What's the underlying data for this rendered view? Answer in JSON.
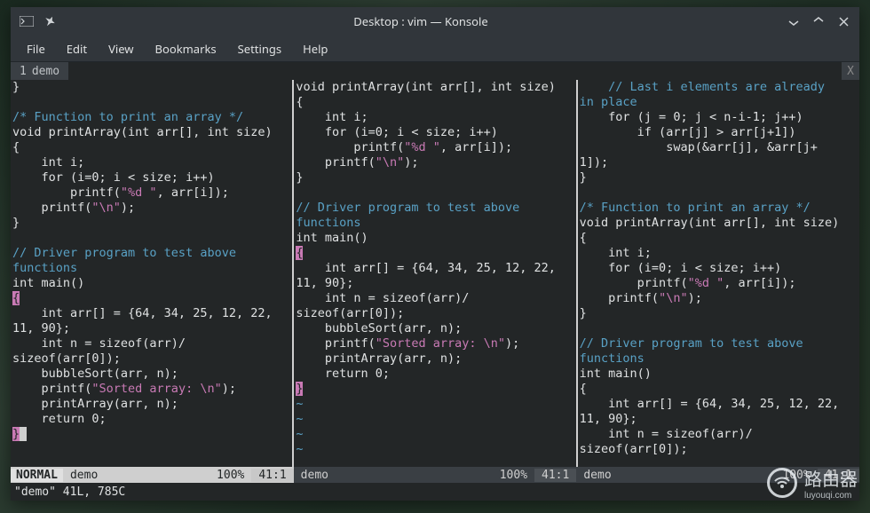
{
  "title": "Desktop : vim — Konsole",
  "menus": [
    "File",
    "Edit",
    "View",
    "Bookmarks",
    "Settings",
    "Help"
  ],
  "tab": {
    "index": "1",
    "name": "demo",
    "close": "X"
  },
  "panes": [
    {
      "lines": [
        {
          "t": "}"
        },
        {
          "t": ""
        },
        {
          "t": "/* Function to print an array */",
          "cls": "cm"
        },
        {
          "t": "void printArray(int arr[], int size)"
        },
        {
          "t": "{"
        },
        {
          "t": "    int i;"
        },
        {
          "t": "    for (i=0; i < size; i++)"
        },
        {
          "t": "        printf(\"%d \", arr[i]);",
          "st": "\"%d \""
        },
        {
          "t": "    printf(\"\\n\");",
          "st": "\"\\n\""
        },
        {
          "t": "}"
        },
        {
          "t": ""
        },
        {
          "t": "// Driver program to test above functions",
          "cls": "cm",
          "wrap": [
            "// Driver program to test above ",
            "functions"
          ]
        },
        {
          "t": "int main()"
        },
        {
          "t": "{",
          "brace": true
        },
        {
          "t": "    int arr[] = {64, 34, 25, 12, 22, 11, 90};",
          "wrap": [
            "    int arr[] = {64, 34, 25, 12, 22, ",
            "11, 90};"
          ]
        },
        {
          "t": "    int n = sizeof(arr)/sizeof(arr[0]);",
          "wrap": [
            "    int n = sizeof(arr)/",
            "sizeof(arr[0]);"
          ]
        },
        {
          "t": "    bubbleSort(arr, n);"
        },
        {
          "t": "    printf(\"Sorted array: \\n\");",
          "st": "\"Sorted array: \\n\""
        },
        {
          "t": "    printArray(arr, n);"
        },
        {
          "t": "    return 0;"
        },
        {
          "t": "}",
          "brace": true,
          "cursor": true
        }
      ],
      "status": {
        "mode": "NORMAL",
        "name": "demo",
        "pct": "100%",
        "pos": "41:1",
        "active": true
      }
    },
    {
      "lines": [
        {
          "t": "void printArray(int arr[], int size)"
        },
        {
          "t": "{"
        },
        {
          "t": "    int i;"
        },
        {
          "t": "    for (i=0; i < size; i++)"
        },
        {
          "t": "        printf(\"%d \", arr[i]);",
          "st": "\"%d \""
        },
        {
          "t": "    printf(\"\\n\");",
          "st": "\"\\n\""
        },
        {
          "t": "}"
        },
        {
          "t": ""
        },
        {
          "t": "// Driver program to test above functions",
          "cls": "cm",
          "wrap": [
            "// Driver program to test above ",
            "functions"
          ]
        },
        {
          "t": "int main()"
        },
        {
          "t": "{",
          "brace": true
        },
        {
          "t": "    int arr[] = {64, 34, 25, 12, 22, 11, 90};",
          "wrap": [
            "    int arr[] = {64, 34, 25, 12, 22, ",
            "11, 90};"
          ]
        },
        {
          "t": "    int n = sizeof(arr)/sizeof(arr[0]);",
          "wrap": [
            "    int n = sizeof(arr)/",
            "sizeof(arr[0]);"
          ]
        },
        {
          "t": "    bubbleSort(arr, n);"
        },
        {
          "t": "    printf(\"Sorted array: \\n\");",
          "st": "\"Sorted array: \\n\""
        },
        {
          "t": "    printArray(arr, n);"
        },
        {
          "t": "    return 0;"
        },
        {
          "t": "}",
          "brace": true
        },
        {
          "t": "~",
          "cls": "tl"
        },
        {
          "t": "~",
          "cls": "tl"
        },
        {
          "t": "~",
          "cls": "tl"
        },
        {
          "t": "~",
          "cls": "tl"
        }
      ],
      "status": {
        "mode": "",
        "name": "demo",
        "pct": "100%",
        "pos": "41:1",
        "active": false
      }
    },
    {
      "lines": [
        {
          "t": "    // Last i elements are already in place",
          "cls": "cm",
          "wrap": [
            "    // Last i elements are already ",
            "in place"
          ]
        },
        {
          "t": "    for (j = 0; j < n-i-1; j++)"
        },
        {
          "t": "        if (arr[j] > arr[j+1])"
        },
        {
          "t": "            swap(&arr[j], &arr[j+1]);",
          "wrap": [
            "            swap(&arr[j], &arr[j+",
            "1]);"
          ]
        },
        {
          "t": "}"
        },
        {
          "t": ""
        },
        {
          "t": "/* Function to print an array */",
          "cls": "cm"
        },
        {
          "t": "void printArray(int arr[], int size)"
        },
        {
          "t": "{"
        },
        {
          "t": "    int i;"
        },
        {
          "t": "    for (i=0; i < size; i++)"
        },
        {
          "t": "        printf(\"%d \", arr[i]);",
          "st": "\"%d \""
        },
        {
          "t": "    printf(\"\\n\");",
          "st": "\"\\n\""
        },
        {
          "t": "}"
        },
        {
          "t": ""
        },
        {
          "t": "// Driver program to test above functions",
          "cls": "cm",
          "wrap": [
            "// Driver program to test above ",
            "functions"
          ]
        },
        {
          "t": "int main()"
        },
        {
          "t": "{"
        },
        {
          "t": "    int arr[] = {64, 34, 25, 12, 22, 11, 90};",
          "wrap": [
            "    int arr[] = {64, 34, 25, 12, 22, ",
            "11, 90};"
          ]
        },
        {
          "t": "    int n = sizeof(arr)/sizeof(arr[0]);",
          "wrap": [
            "    int n = sizeof(arr)/",
            "sizeof(arr[0]);"
          ]
        }
      ],
      "status": {
        "mode": "",
        "name": "demo",
        "pct": "100%",
        "pos": "41:1",
        "active": false
      }
    }
  ],
  "message": "\"demo\" 41L, 785C",
  "watermark": {
    "main": "路由器",
    "sub": "luyouqi.com"
  }
}
